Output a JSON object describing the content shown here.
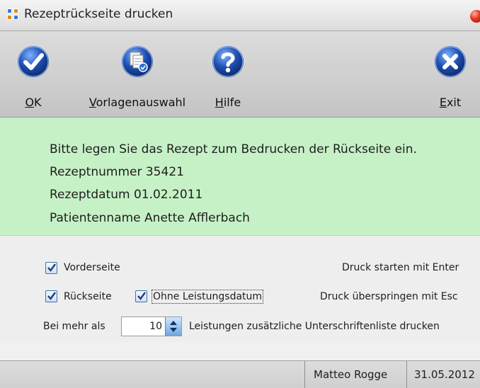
{
  "window": {
    "title": "Rezeptrückseite drucken"
  },
  "toolbar": {
    "ok": {
      "prefix": "",
      "accel": "O",
      "rest": "K",
      "icon": "checkmark-icon"
    },
    "template": {
      "prefix": "",
      "accel": "V",
      "rest": "orlagenauswahl",
      "icon": "template-select-icon"
    },
    "help": {
      "prefix": "",
      "accel": "H",
      "rest": "ilfe",
      "icon": "help-icon"
    },
    "exit": {
      "prefix": "",
      "accel": "E",
      "rest": "xit",
      "icon": "exit-icon"
    }
  },
  "info": {
    "line1": "Bitte legen Sie das Rezept zum Bedrucken der Rückseite ein.",
    "line2": "Rezeptnummer 35421",
    "line3": "Rezeptdatum 01.02.2011",
    "line4": "Patientenname Anette Afflerbach"
  },
  "options": {
    "front": {
      "label": "Vorderseite",
      "checked": true
    },
    "back": {
      "label": "Rückseite",
      "checked": true
    },
    "no_date": {
      "label": "Ohne Leistungsdatum",
      "checked": true
    },
    "hint_enter": "Druck starten mit Enter",
    "hint_esc": "Druck überspringen mit Esc",
    "more_than_label": "Bei mehr als",
    "more_than_value": "10",
    "more_than_suffix": "Leistungen zusätzliche Unterschriftenliste drucken"
  },
  "status": {
    "user": "Matteo Rogge",
    "date": "31.05.2012"
  },
  "colors": {
    "info_bg": "#c6f1c6",
    "icon_blue": "#1f4fb0"
  }
}
